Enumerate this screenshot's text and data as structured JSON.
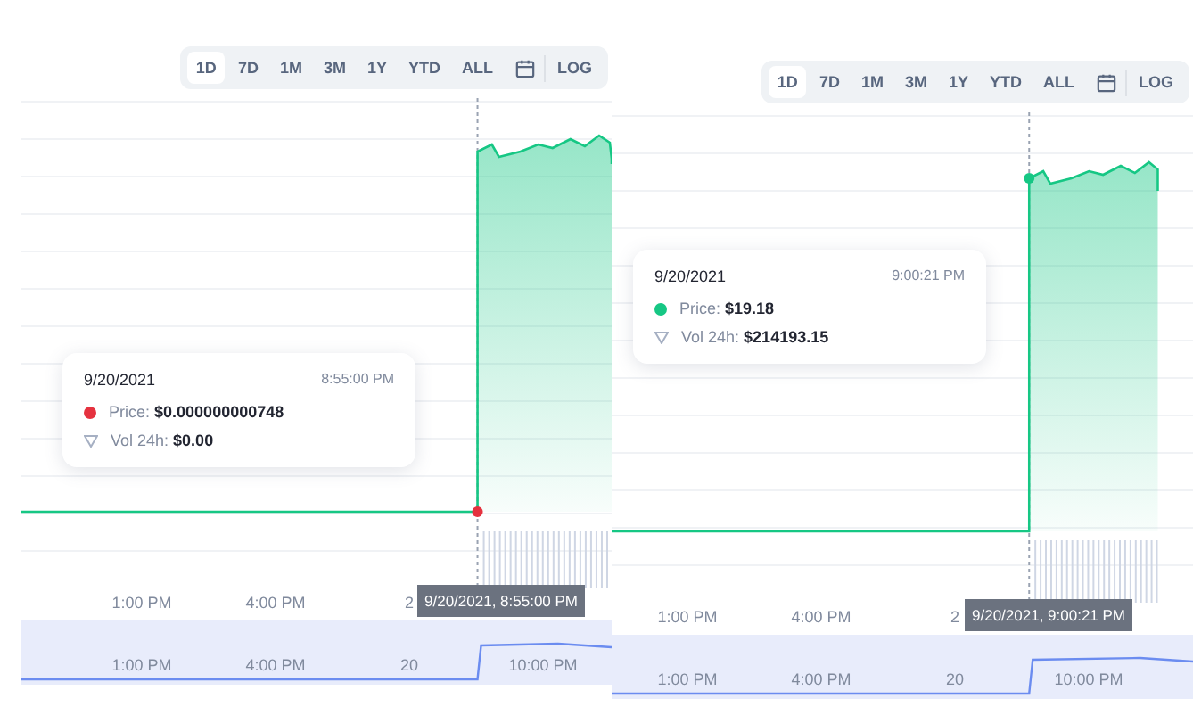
{
  "panels": [
    {
      "ranges": [
        {
          "label": "1D",
          "selected": true
        },
        {
          "label": "7D",
          "selected": false
        },
        {
          "label": "1M",
          "selected": false
        },
        {
          "label": "3M",
          "selected": false
        },
        {
          "label": "1Y",
          "selected": false
        },
        {
          "label": "YTD",
          "selected": false
        },
        {
          "label": "ALL",
          "selected": false
        }
      ],
      "log_button": "LOG",
      "marker_at_top": false,
      "tooltip": {
        "date": "9/20/2021",
        "time": "8:55:00 PM",
        "price_label": "Price:",
        "price": "$0.000000000748",
        "color": "#e5323f",
        "volume_label": "Vol 24h:",
        "volume": "$0.00"
      },
      "x_axis": [
        "1:00 PM",
        "4:00 PM",
        "2"
      ],
      "crosshair_label": "9/20/2021, 8:55:00 PM",
      "navigator_labels": [
        "1:00 PM",
        "4:00 PM",
        "20",
        "10:00 PM"
      ]
    },
    {
      "ranges": [
        {
          "label": "1D",
          "selected": true
        },
        {
          "label": "7D",
          "selected": false
        },
        {
          "label": "1M",
          "selected": false
        },
        {
          "label": "3M",
          "selected": false
        },
        {
          "label": "1Y",
          "selected": false
        },
        {
          "label": "YTD",
          "selected": false
        },
        {
          "label": "ALL",
          "selected": false
        }
      ],
      "log_button": "LOG",
      "marker_at_top": true,
      "tooltip": {
        "date": "9/20/2021",
        "time": "9:00:21 PM",
        "price_label": "Price:",
        "price": "$19.18",
        "color": "#16c784",
        "volume_label": "Vol 24h:",
        "volume": "$214193.15"
      },
      "x_axis": [
        "1:00 PM",
        "4:00 PM",
        "2"
      ],
      "crosshair_label": "9/20/2021, 9:00:21 PM",
      "navigator_labels": [
        "1:00 PM",
        "4:00 PM",
        "20",
        "10:00 PM"
      ]
    }
  ]
}
